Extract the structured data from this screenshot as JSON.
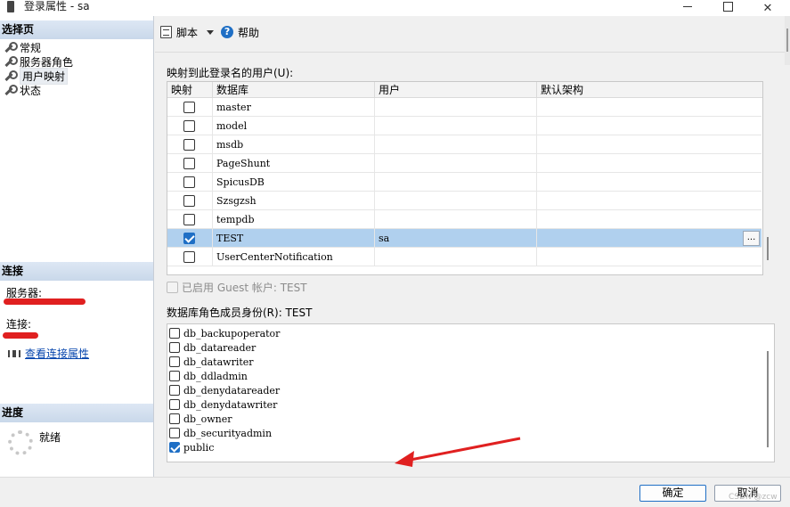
{
  "window": {
    "title": "登录属性 - sa"
  },
  "left_pane": {
    "select_page_header": "选择页",
    "nav_items": [
      {
        "label": "常规",
        "selected": false
      },
      {
        "label": "服务器角色",
        "selected": false
      },
      {
        "label": "用户映射",
        "selected": true
      },
      {
        "label": "状态",
        "selected": false
      }
    ],
    "connection_header": "连接",
    "server_label": "服务器:",
    "connection_label": "连接:",
    "view_connection_link": "查看连接属性",
    "progress_header": "进度",
    "progress_status": "就绪"
  },
  "toolbar": {
    "script_label": "脚本",
    "help_label": "帮助"
  },
  "mapping": {
    "label": "映射到此登录名的用户(U):",
    "columns": [
      "映射",
      "数据库",
      "用户",
      "默认架构"
    ],
    "rows": [
      {
        "mapped": false,
        "database": "master",
        "user": "",
        "schema": ""
      },
      {
        "mapped": false,
        "database": "model",
        "user": "",
        "schema": ""
      },
      {
        "mapped": false,
        "database": "msdb",
        "user": "",
        "schema": ""
      },
      {
        "mapped": false,
        "database": "PageShunt",
        "user": "",
        "schema": ""
      },
      {
        "mapped": false,
        "database": "SpicusDB",
        "user": "",
        "schema": ""
      },
      {
        "mapped": false,
        "database": "Szsgzsh",
        "user": "",
        "schema": ""
      },
      {
        "mapped": false,
        "database": "tempdb",
        "user": "",
        "schema": ""
      },
      {
        "mapped": true,
        "database": "TEST",
        "user": "sa",
        "schema": "",
        "selected": true
      },
      {
        "mapped": false,
        "database": "UserCenterNotification",
        "user": "",
        "schema": ""
      }
    ],
    "ellipsis_label": "...",
    "guest_label": "已启用 Guest 帐户: TEST"
  },
  "roles": {
    "label": "数据库角色成员身份(R): TEST",
    "items": [
      {
        "name": "db_backupoperator",
        "checked": false
      },
      {
        "name": "db_datareader",
        "checked": false
      },
      {
        "name": "db_datawriter",
        "checked": false
      },
      {
        "name": "db_ddladmin",
        "checked": false
      },
      {
        "name": "db_denydatareader",
        "checked": false
      },
      {
        "name": "db_denydatawriter",
        "checked": false
      },
      {
        "name": "db_owner",
        "checked": false
      },
      {
        "name": "db_securityadmin",
        "checked": false
      },
      {
        "name": "public",
        "checked": true
      }
    ]
  },
  "buttons": {
    "ok": "确定",
    "cancel": "取消"
  },
  "watermark": "CSDN @zcw",
  "colors": {
    "accent": "#1f6fc5",
    "annotation_red": "#e02020",
    "selected_row": "#b0d0ee"
  }
}
